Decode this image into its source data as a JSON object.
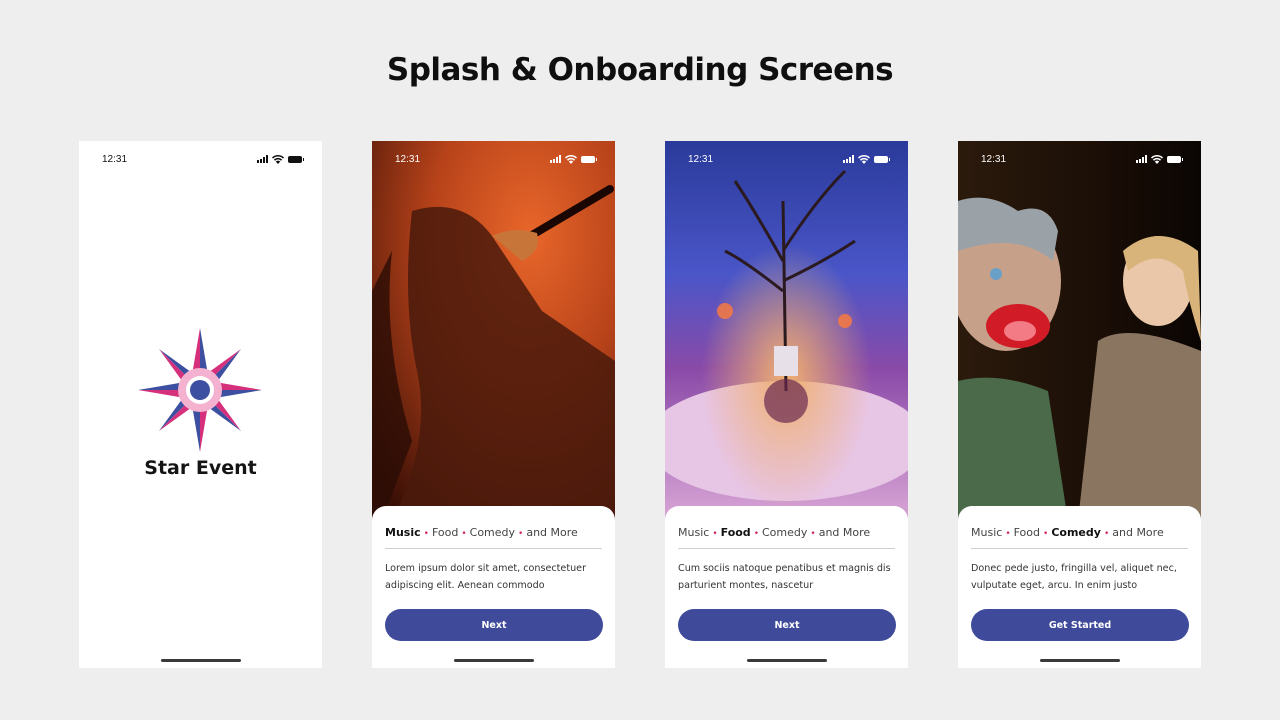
{
  "page_title": "Splash & Onboarding Screens",
  "status_time": "12:31",
  "splash": {
    "brand_name": "Star Event"
  },
  "onboarding": [
    {
      "categories": [
        "Music",
        "Food",
        "Comedy",
        "and More"
      ],
      "active_category": "Music",
      "description": "Lorem ipsum dolor sit amet, consectetuer adipiscing elit. Aenean commodo",
      "button_label": "Next"
    },
    {
      "categories": [
        "Music",
        "Food",
        "Comedy",
        "and More"
      ],
      "active_category": "Food",
      "description": "Cum sociis natoque penatibus et magnis dis parturient montes, nascetur",
      "button_label": "Next"
    },
    {
      "categories": [
        "Music",
        "Food",
        "Comedy",
        "and More"
      ],
      "active_category": "Comedy",
      "description": "Donec pede justo, fringilla vel, aliquet nec, vulputate eget, arcu. In enim justo",
      "button_label": "Get Started"
    }
  ],
  "colors": {
    "accent": "#3f4b9a",
    "bullet": "#d02a62",
    "logo_pink": "#d62f7c",
    "logo_blue": "#3d4fa0"
  }
}
